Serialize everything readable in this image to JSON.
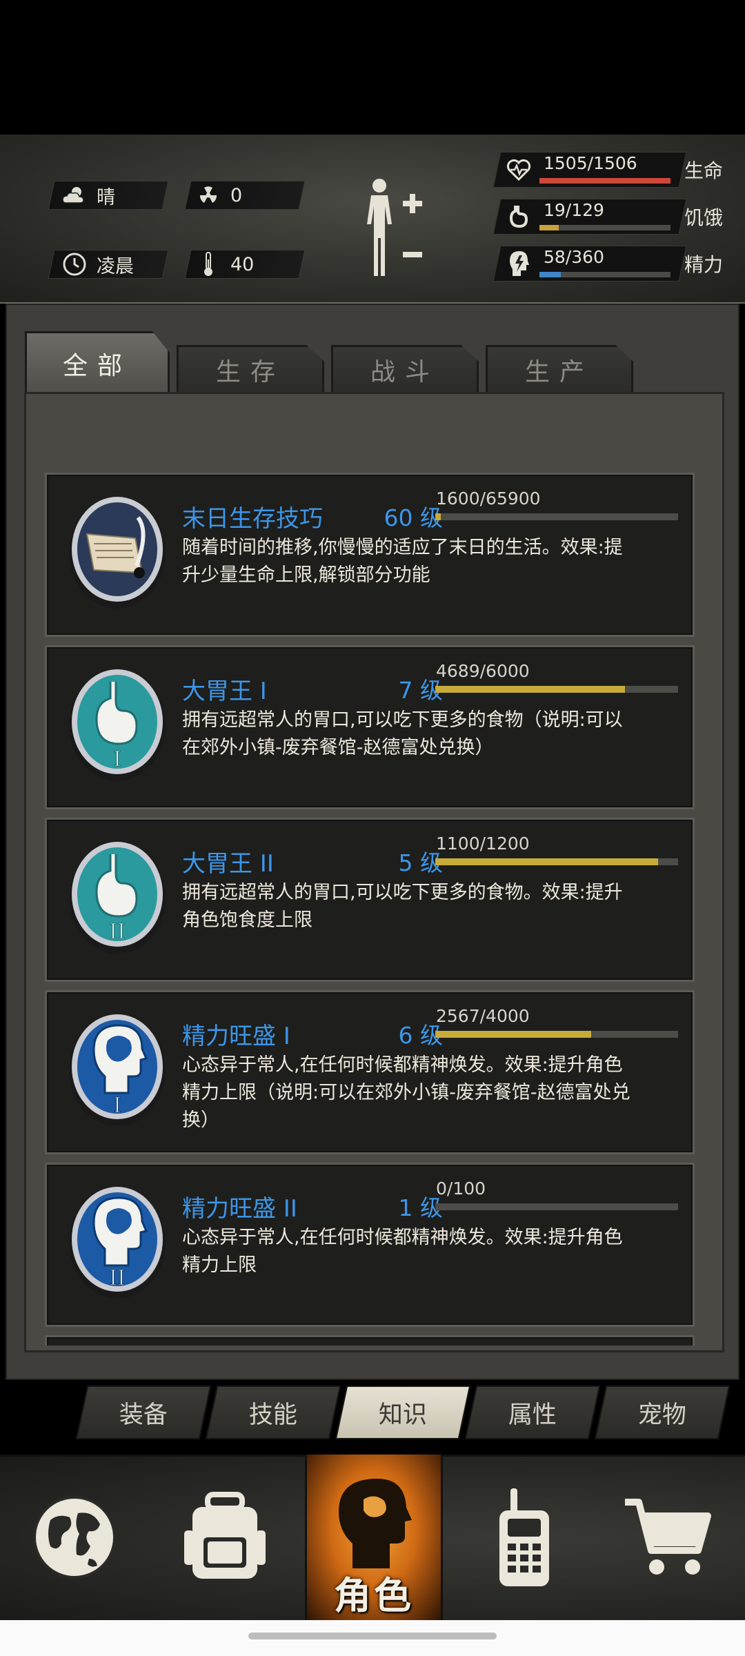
{
  "environment": {
    "weather": "晴",
    "radiation": "0",
    "time_of_day": "凌晨",
    "temperature": "40"
  },
  "stats": [
    {
      "value": "1505/1506",
      "label": "生命",
      "icon": "heart-pulse-icon",
      "fill": 0.999,
      "color": "#d0473a"
    },
    {
      "value": "19/129",
      "label": "饥饿",
      "icon": "stomach-icon",
      "fill": 0.147,
      "color": "#c8a23a"
    },
    {
      "value": "58/360",
      "label": "精力",
      "icon": "energy-head-icon",
      "fill": 0.161,
      "color": "#3f86c8"
    }
  ],
  "tabs": [
    "全部",
    "生存",
    "战斗",
    "生产"
  ],
  "active_tab": 0,
  "skills": [
    {
      "name": "末日生存技巧",
      "level": "60 级",
      "progress": "1600/65900",
      "fill": 0.024,
      "desc": "随着时间的推移,你慢慢的适应了末日的生活。效果:提升少量生命上限,解锁部分功能",
      "icon": "scroll-quill-icon"
    },
    {
      "name": "大胃王 I",
      "level": "7 级",
      "progress": "4689/6000",
      "fill": 0.78,
      "desc": "拥有远超常人的胃口,可以吃下更多的食物（说明:可以在郊外小镇-废弃餐馆-赵德富处兑换）",
      "icon": "stomach-1-icon"
    },
    {
      "name": "大胃王 II",
      "level": "5 级",
      "progress": "1100/1200",
      "fill": 0.917,
      "desc": "拥有远超常人的胃口,可以吃下更多的食物。效果:提升角色饱食度上限",
      "icon": "stomach-2-icon"
    },
    {
      "name": "精力旺盛 I",
      "level": "6 级",
      "progress": "2567/4000",
      "fill": 0.642,
      "desc": "心态异于常人,在任何时候都精神焕发。效果:提升角色精力上限（说明:可以在郊外小镇-废弃餐馆-赵德富处兑换）",
      "icon": "brain-head-1-icon"
    },
    {
      "name": "精力旺盛 II",
      "level": "1 级",
      "progress": "0/100",
      "fill": 0,
      "desc": "心态异于常人,在任何时候都精神焕发。效果:提升角色精力上限",
      "icon": "brain-head-2-icon"
    }
  ],
  "subtabs": [
    "装备",
    "技能",
    "知识",
    "属性",
    "宠物"
  ],
  "active_subtab": 2,
  "nav": {
    "items": [
      "globe-icon",
      "backpack-icon",
      "character-icon",
      "walkie-talkie-icon",
      "shopping-cart-icon"
    ],
    "active_label": "角色"
  }
}
